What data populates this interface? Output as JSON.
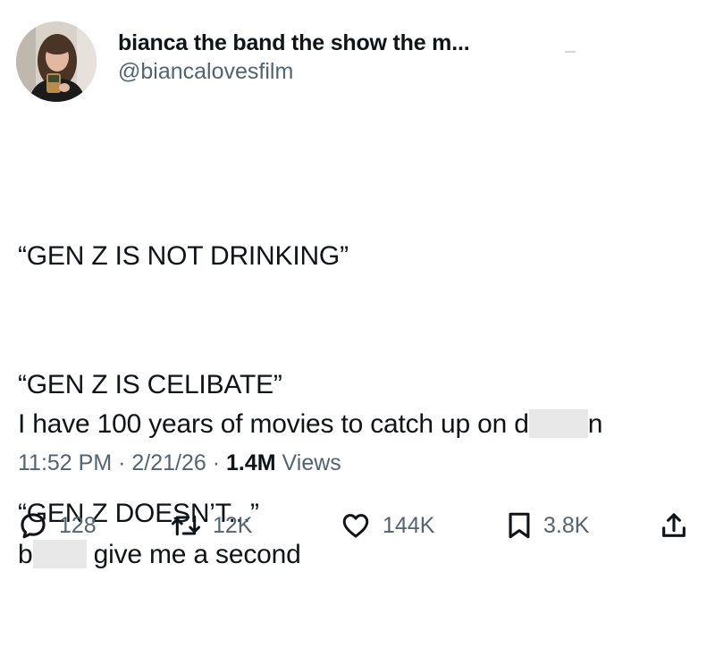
{
  "author": {
    "display_name": "bianca the band the show the m...",
    "handle": "@biancalovesfilm"
  },
  "post": {
    "quote_lines": [
      "“GEN Z IS NOT DRINKING”",
      "“GEN Z IS CELIBATE”",
      "“GEN Z DOESN’T...”"
    ],
    "line1_before": "I have 100 years of movies to catch up on d",
    "line1_after": "n",
    "line2_before": "b",
    "line2_after": " give me a second"
  },
  "meta": {
    "time": "11:52 PM",
    "separator": " · ",
    "date": "2/21/26",
    "views_count": "1.4M",
    "views_label": " Views"
  },
  "actions": {
    "replies": "128",
    "reposts": "12K",
    "likes": "144K",
    "bookmarks": "3.8K"
  },
  "icons": {
    "reply": "reply-icon",
    "repost": "repost-icon",
    "like": "heart-icon",
    "bookmark": "bookmark-icon",
    "share": "share-icon"
  },
  "colors": {
    "text_primary": "#0f1419",
    "text_secondary": "#536471",
    "censor_block": "#e8e8e8"
  }
}
